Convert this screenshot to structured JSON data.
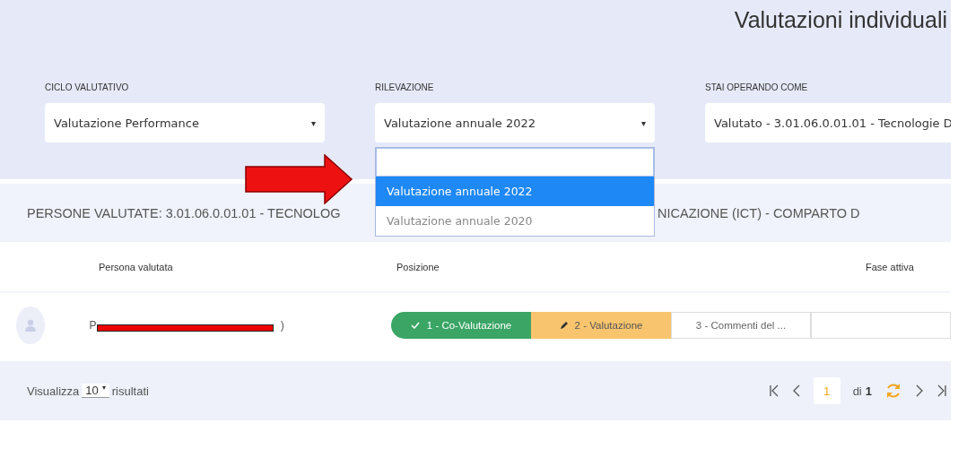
{
  "page": {
    "title": "Valutazioni individuali"
  },
  "filters": [
    {
      "label": "CICLO VALUTATIVO",
      "value": "Valutazione Performance",
      "caret": "▾"
    },
    {
      "label": "RILEVAZIONE",
      "value": "Valutazione annuale 2022",
      "caret": "▾",
      "expanded": true
    },
    {
      "label": "STAI OPERANDO COME",
      "value": "Valutato - 3.01.06.0.01.01 - Tecnologie D"
    }
  ],
  "dropdown": {
    "options": [
      {
        "label": "Valutazione annuale 2022",
        "selected": true
      },
      {
        "label": "Valutazione annuale 2020",
        "selected": false
      }
    ]
  },
  "section": {
    "title_start": "PERSONE VALUTATE: 3.01.06.0.01.01 - TECNOLOG",
    "title_end": "NICAZIONE (ICT) - COMPARTO D"
  },
  "table": {
    "columns": [
      "Persona valutata",
      "Posizione",
      "Fase attiva"
    ],
    "rows": [
      {
        "name_start": "P",
        "name_end": ")",
        "redacted": true,
        "steps": [
          {
            "label": "1 - Co-Valutazione",
            "kind": "done"
          },
          {
            "label": "2 - Valutazione",
            "kind": "active"
          },
          {
            "label": "3 - Commenti del ...",
            "kind": "pending"
          },
          {
            "kind": "pending"
          }
        ]
      }
    ]
  },
  "footer": {
    "show_before": "Visualizza",
    "page_size": "10",
    "page_size_caret": "▾",
    "show_after": "risultati",
    "pagination": {
      "current": "1",
      "of": "di",
      "total": "1"
    }
  },
  "annotation": {
    "arrow": true
  }
}
